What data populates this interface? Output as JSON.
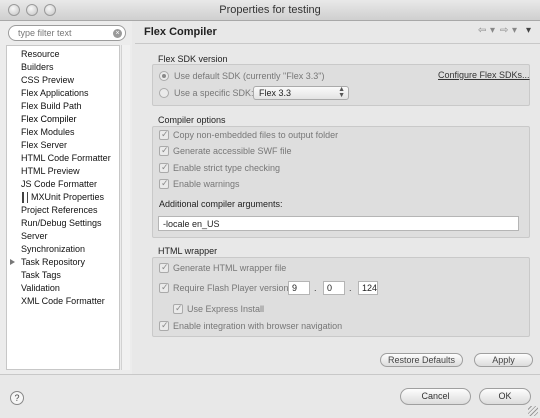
{
  "window": {
    "title": "Properties for testing"
  },
  "filter": {
    "placeholder": "type filter text"
  },
  "tree": {
    "items": [
      "Resource",
      "Builders",
      "CSS Preview",
      "Flex Applications",
      "Flex Build Path",
      "Flex Compiler",
      "Flex Modules",
      "Flex Server",
      "HTML Code Formatter",
      "HTML Preview",
      "JS Code Formatter",
      "MXUnit Properties",
      "Project References",
      "Run/Debug Settings",
      "Server",
      "Synchronization",
      "Task Repository",
      "Task Tags",
      "Validation",
      "XML Code Formatter"
    ],
    "selected": "Flex Compiler"
  },
  "page": {
    "title": "Flex Compiler"
  },
  "nav": {
    "back": "⇦",
    "back_menu": "▾",
    "forward": "⇨",
    "forward_menu": "▾",
    "view_menu": "▾"
  },
  "sdk": {
    "section_title": "Flex SDK version",
    "use_default_label": "Use default SDK (currently \"Flex 3.3\")",
    "configure_link": "Configure Flex SDKs...",
    "use_specific_label": "Use a specific SDK:",
    "specific_value": "Flex 3.3"
  },
  "compiler": {
    "section_title": "Compiler options",
    "options": [
      "Copy non-embedded files to output folder",
      "Generate accessible SWF file",
      "Enable strict type checking",
      "Enable warnings"
    ],
    "args_label": "Additional compiler arguments:",
    "args_value": "-locale en_US"
  },
  "wrapper": {
    "section_title": "HTML wrapper",
    "generate_label": "Generate HTML wrapper file",
    "require_label": "Require Flash Player version:",
    "version_major": "9",
    "version_minor": "0",
    "version_revision": "124",
    "express_label": "Use Express Install",
    "navigation_label": "Enable integration with browser navigation"
  },
  "buttons": {
    "restore_defaults": "Restore Defaults",
    "apply": "Apply",
    "cancel": "Cancel",
    "ok": "OK",
    "help": "?"
  }
}
